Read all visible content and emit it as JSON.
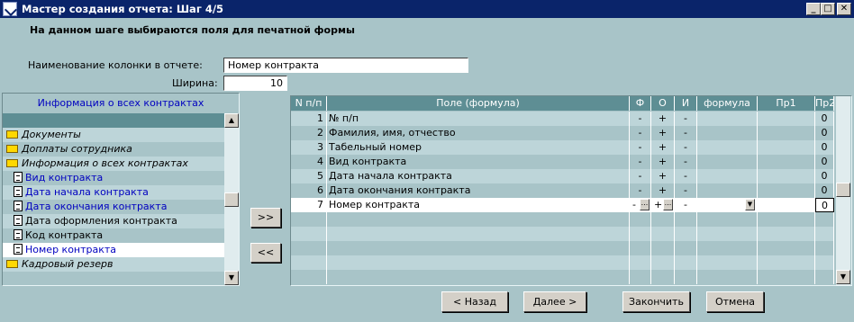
{
  "window": {
    "title": "Мастер создания отчета: Шаг 4/5"
  },
  "header": {
    "text": "На данном шаге выбираются поля для печатной формы"
  },
  "form": {
    "column_name_label": "Наименование колонки в отчете:",
    "column_name_value": "Номер контракта",
    "width_label": "Ширина:",
    "width_value": "10"
  },
  "tree": {
    "header": "Информация о всех контрактах",
    "items": [
      {
        "label": "Документы",
        "type": "folder"
      },
      {
        "label": "Доплаты сотрудника",
        "type": "folder"
      },
      {
        "label": "Информация о всех контрактах",
        "type": "folder-open"
      },
      {
        "label": "Вид контракта",
        "type": "doc"
      },
      {
        "label": "Дата начала контракта",
        "type": "doc"
      },
      {
        "label": "Дата окончания контракта",
        "type": "doc"
      },
      {
        "label": "Дата оформления контракта",
        "type": "doc"
      },
      {
        "label": "Код контракта",
        "type": "doc"
      },
      {
        "label": "Номер контракта",
        "type": "doc"
      },
      {
        "label": "Кадровый резерв",
        "type": "folder"
      }
    ]
  },
  "transfer": {
    "add_label": ">>",
    "remove_label": "<<"
  },
  "grid": {
    "columns": [
      "N п/п",
      "Поле (формула)",
      "Ф",
      "О",
      "И",
      "формула",
      "Пр1",
      "Пр2"
    ],
    "rows": [
      {
        "n": "1",
        "field": "№ п/п",
        "f": "-",
        "o": "+",
        "i": "-",
        "formula": "",
        "pr1": "",
        "pr2": "0"
      },
      {
        "n": "2",
        "field": "Фамилия, имя, отчество",
        "f": "-",
        "o": "+",
        "i": "-",
        "formula": "",
        "pr1": "",
        "pr2": "0"
      },
      {
        "n": "3",
        "field": "Табельный номер",
        "f": "-",
        "o": "+",
        "i": "-",
        "formula": "",
        "pr1": "",
        "pr2": "0"
      },
      {
        "n": "4",
        "field": "Вид контракта",
        "f": "-",
        "o": "+",
        "i": "-",
        "formula": "",
        "pr1": "",
        "pr2": "0"
      },
      {
        "n": "5",
        "field": "Дата начала контракта",
        "f": "-",
        "o": "+",
        "i": "-",
        "formula": "",
        "pr1": "",
        "pr2": "0"
      },
      {
        "n": "6",
        "field": "Дата окончания контракта",
        "f": "-",
        "o": "+",
        "i": "-",
        "formula": "",
        "pr1": "",
        "pr2": "0"
      },
      {
        "n": "7",
        "field": "Номер контракта",
        "f": "-",
        "o": "+",
        "i": "-",
        "formula": "",
        "pr1": "",
        "pr2": "0"
      }
    ],
    "ellipsis": "..."
  },
  "footer": {
    "back_label": "< Назад",
    "next_label": "Далее >",
    "finish_label": "Закончить",
    "cancel_label": "Отмена"
  }
}
